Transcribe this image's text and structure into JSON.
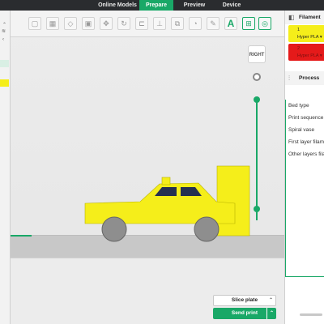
{
  "tabs": [
    {
      "label": "Online Models"
    },
    {
      "label": "Prepare",
      "active": true
    },
    {
      "label": "Preview"
    },
    {
      "label": "Device"
    }
  ],
  "viewport": {
    "view_cube_label": "RIGHT"
  },
  "actions": {
    "slice_label": "Slice plate",
    "send_label": "Send print"
  },
  "filament": {
    "title": "Filament",
    "items": [
      {
        "index": "1",
        "name": "Hyper PLA",
        "color": "#f5ee1a"
      },
      {
        "index": "2",
        "name": "Hyper PLA",
        "color": "#e51a1a"
      }
    ]
  },
  "process": {
    "title": "Process",
    "items": [
      "Bed type",
      "Print sequence",
      "Spiral vase",
      "First layer filament",
      "Other layers filament"
    ]
  },
  "colors": {
    "accent": "#19a867",
    "topbar": "#2a2c2f",
    "model": "#f5ee1a"
  }
}
